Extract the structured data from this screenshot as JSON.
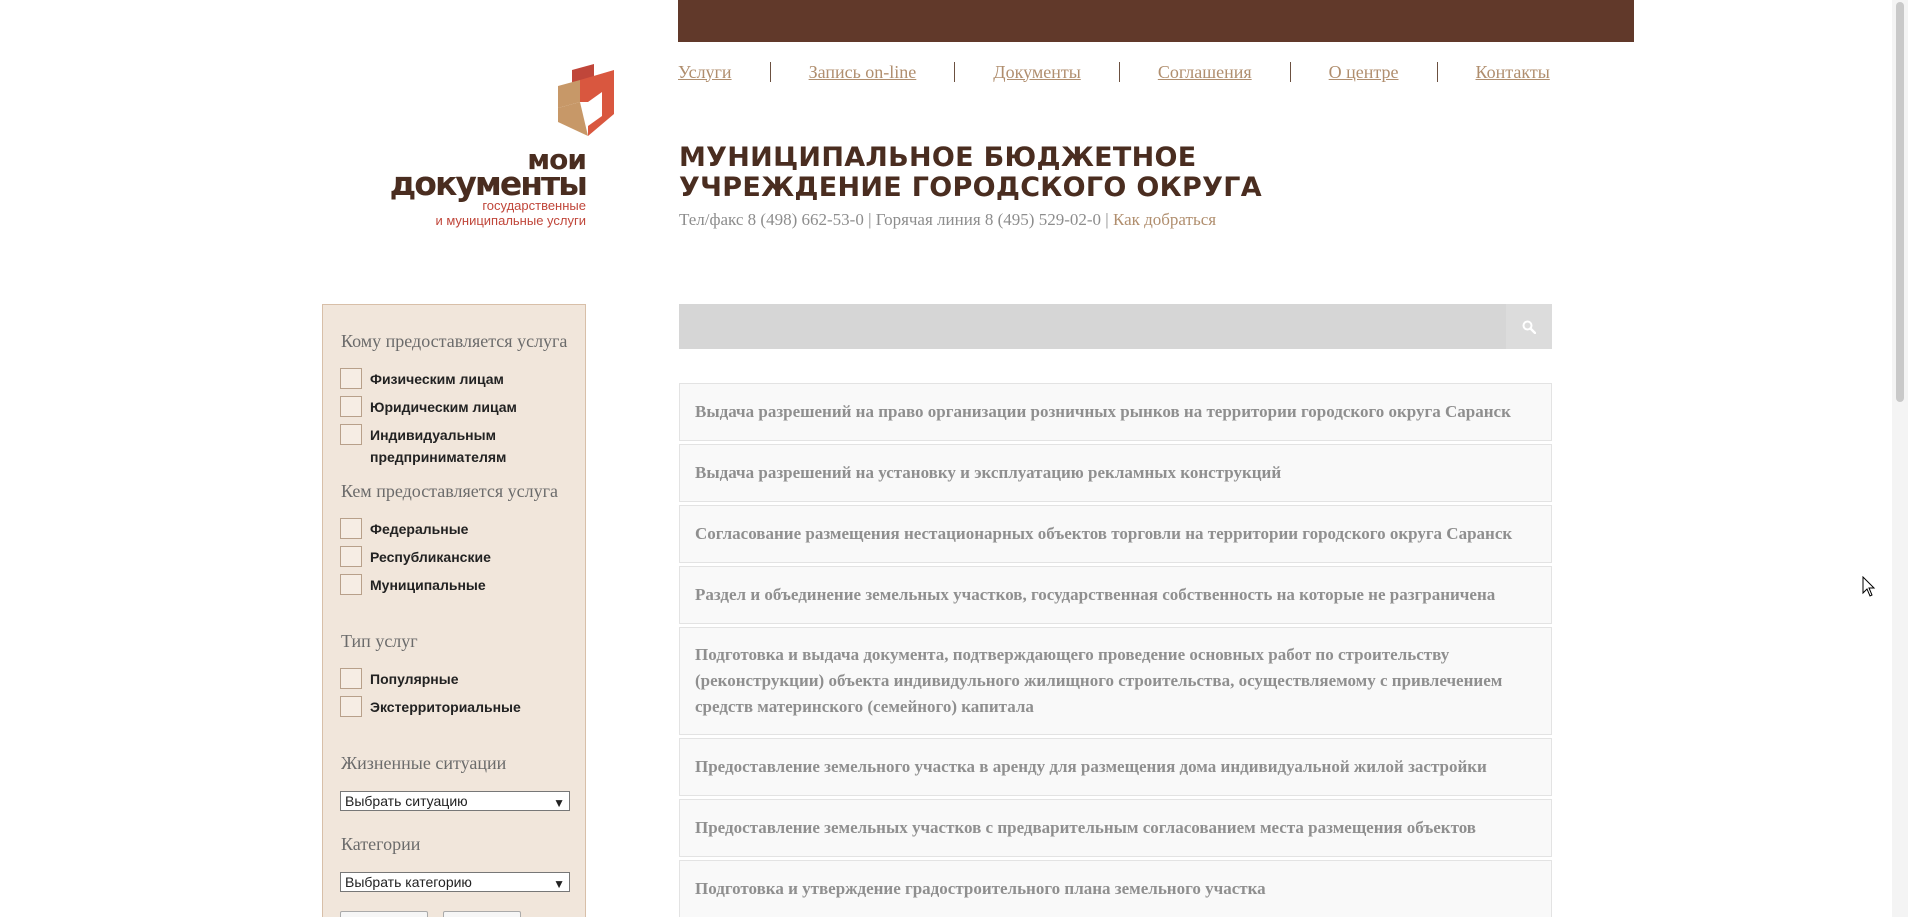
{
  "nav": {
    "items": [
      {
        "label": "Услуги"
      },
      {
        "label": "Запись on-line"
      },
      {
        "label": "Документы"
      },
      {
        "label": "Соглашения"
      },
      {
        "label": "О центре"
      },
      {
        "label": "Контакты"
      }
    ]
  },
  "logo": {
    "line1": "мои",
    "line2": "документы",
    "sub1": "государственные",
    "sub2": "и муниципальные услуги"
  },
  "org": {
    "title": "МУНИЦИПАЛЬНОЕ БЮДЖЕТНОЕ УЧРЕЖДЕНИЕ ГОРОДСКОГО ОКРУГА",
    "phones": "Тел/факс 8 (498) 662-53-0 | Горячая линия 8 (495) 529-02-0 |",
    "directions_link": "Как добраться"
  },
  "filters": {
    "recipients": {
      "heading": "Кому предоставляется услуга",
      "options": [
        "Физическим лицам",
        "Юридическим лицам",
        "Индивидуальным предпринимателям"
      ]
    },
    "providers": {
      "heading": "Кем предоставляется услуга",
      "options": [
        "Федеральные",
        "Республиканские",
        "Муниципальные"
      ]
    },
    "types": {
      "heading": "Тип услуг",
      "options": [
        "Популярные",
        "Экстерриториальные"
      ]
    },
    "situations": {
      "heading": "Жизненные ситуации",
      "select_value": "Выбрать ситуацию"
    },
    "categories": {
      "heading": "Категории",
      "select_value": "Выбрать категорию"
    }
  },
  "search": {
    "placeholder": "",
    "icon": "search-icon"
  },
  "services": [
    "Выдача разрешений на право организации розничных рынков на территории городского округа Саранск",
    "Выдача разрешений на установку и эксплуатацию рекламных конструкций",
    "Согласование размещения нестационарных объектов торговли на территории городского округа Саранск",
    "Раздел и объединение земельных участков, государственная собственность на которые не разграничена",
    "Подготовка и выдача документа, подтверждающего проведение основных работ по строительству (реконструкции) объекта индивидульного жилищного строительства, осуществляемому с привлечением средств материнского (семейного) капитала",
    "Предоставление земельного участка в аренду для размещения дома индивидуальной жилой застройки",
    "Предоставление земельных участков с предварительным согласованием места размещения объектов",
    "Подготовка и утверждение градостроительного плана земельного участка"
  ],
  "colors": {
    "brand_brown": "#61392a",
    "link_tan": "#b08e6e",
    "filter_bg": "#f1e6db",
    "logo_red": "#c0463a"
  }
}
